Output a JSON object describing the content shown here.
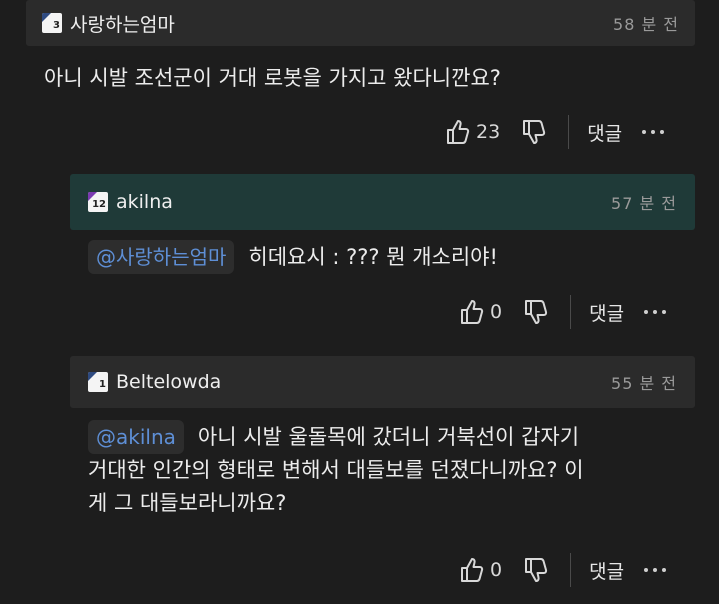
{
  "comments": [
    {
      "author": "사랑하는엄마",
      "level": "3",
      "time": "58 분 전",
      "text": "아니 시발 조선군이 거대 로봇을 가지고 왔다니깐요?",
      "likes": "23",
      "reply_label": "댓글"
    },
    {
      "author": "akilna",
      "level": "12",
      "time": "57 분 전",
      "mention": "@사랑하는엄마",
      "text": "히데요시 : ??? 뭔 개소리야!",
      "likes": "0",
      "reply_label": "댓글"
    },
    {
      "author": "Beltelowda",
      "level": "1",
      "time": "55 분 전",
      "mention": "@akilna",
      "text_line1": "아니 시발 울돌목에 갔더니 거북선이 갑자기",
      "text_line2": "거대한 인간의 형태로 변해서 대들보를 던졌다니까요? 이",
      "text_line3": "게 그 대들보라니까요?",
      "likes": "0",
      "reply_label": "댓글"
    }
  ],
  "colors": {
    "background": "#1d1d1d",
    "header_default": "#2b2b2b",
    "header_highlight": "#1f3a38",
    "mention": "#5e8fd6"
  }
}
